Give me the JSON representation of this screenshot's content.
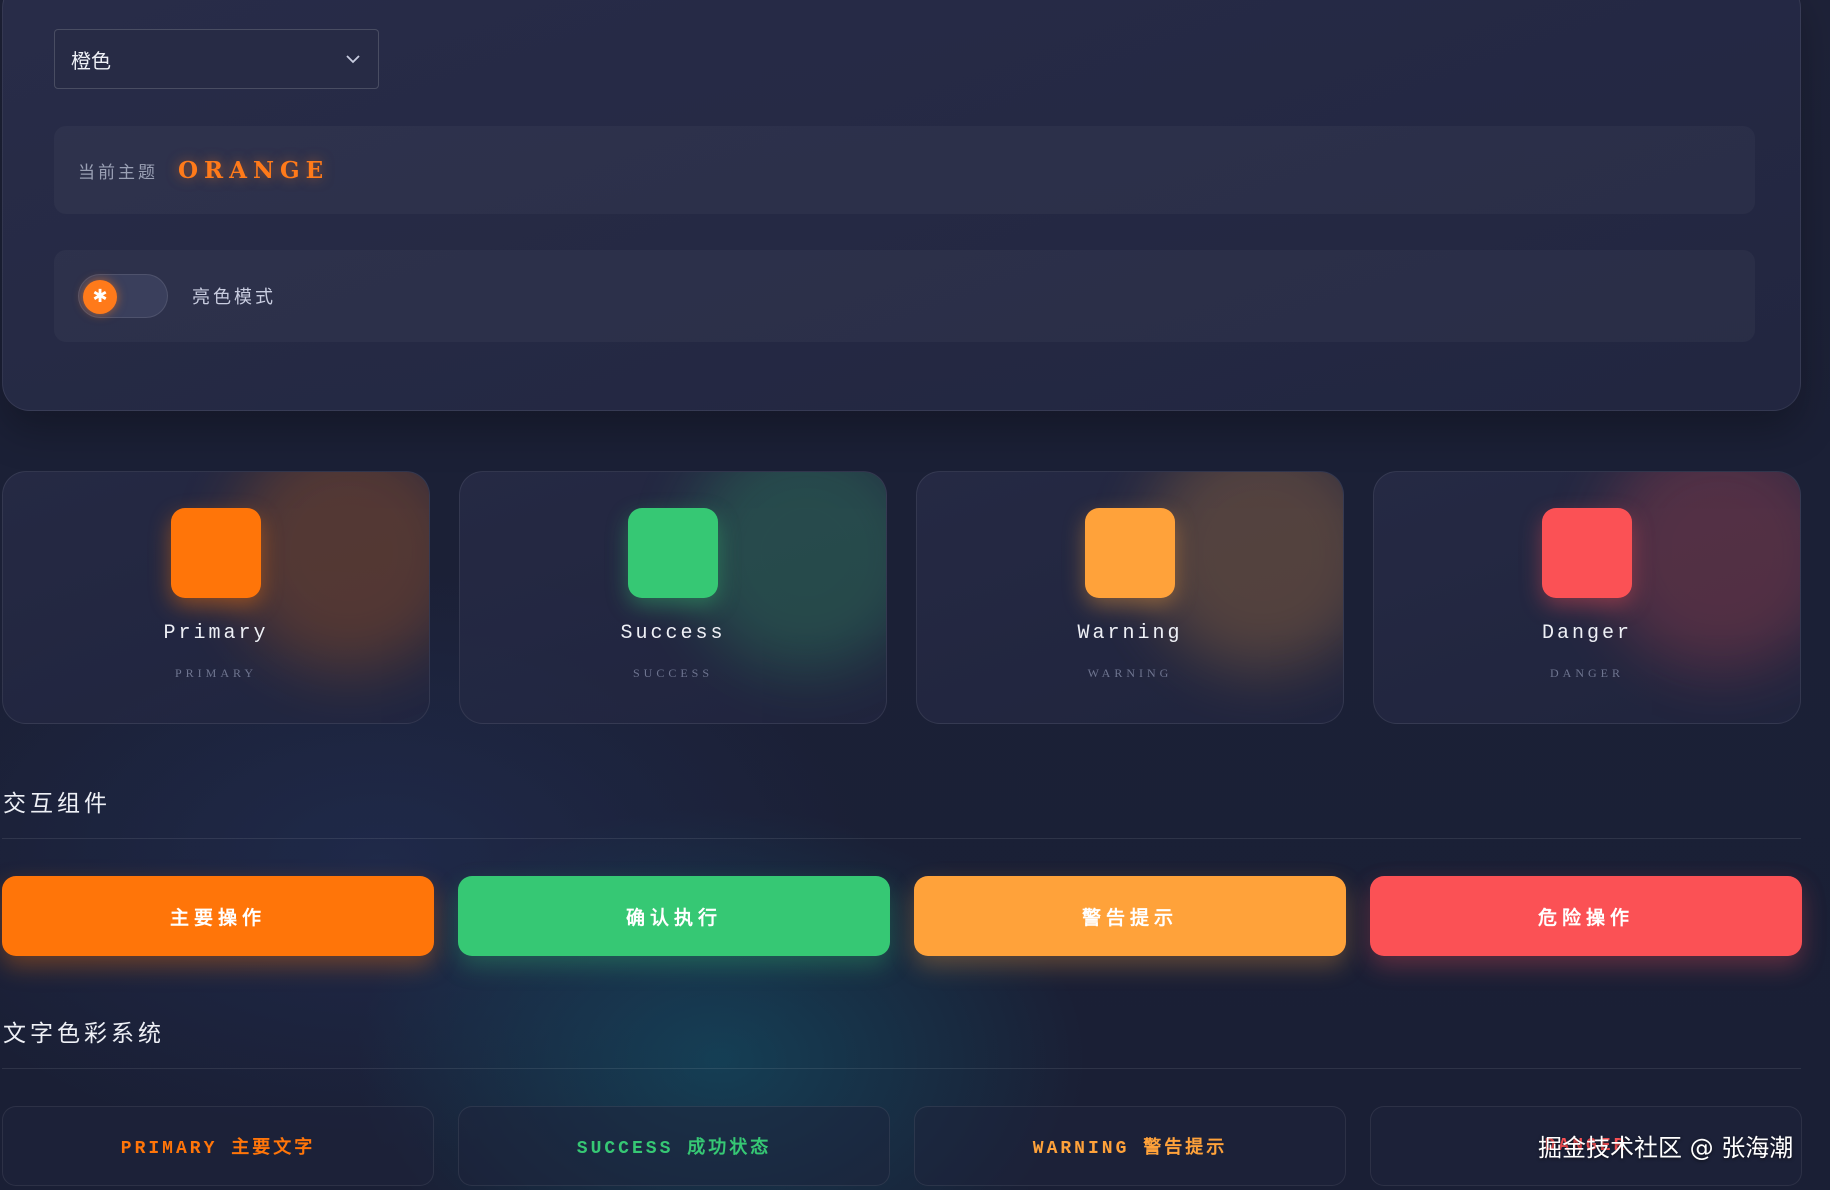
{
  "theme_select": {
    "value": "橙色"
  },
  "current_theme": {
    "label": "当前主题",
    "value": "ORANGE"
  },
  "light_mode": {
    "label": "亮色模式",
    "icon": "sun-icon"
  },
  "colors": {
    "primary": "#ff7509",
    "success": "#36c874",
    "warning": "#ffa23a",
    "danger": "#fb5155"
  },
  "cards": [
    {
      "name": "Primary",
      "sub": "PRIMARY",
      "color": "#ff7509"
    },
    {
      "name": "Success",
      "sub": "SUCCESS",
      "color": "#36c874"
    },
    {
      "name": "Warning",
      "sub": "WARNING",
      "color": "#ffa23a"
    },
    {
      "name": "Danger",
      "sub": "DANGER",
      "color": "#fb5155"
    }
  ],
  "sections": {
    "interactive": "交互组件",
    "text_colors": "文字色彩系统"
  },
  "buttons": [
    {
      "label": "主要操作"
    },
    {
      "label": "确认执行"
    },
    {
      "label": "警告提示"
    },
    {
      "label": "危险操作"
    }
  ],
  "text_samples": [
    {
      "label": "PRIMARY 主要文字"
    },
    {
      "label": "SUCCESS 成功状态"
    },
    {
      "label": "WARNING 警告提示"
    },
    {
      "label": "DANGER"
    }
  ],
  "watermark": "掘金技术社区 @ 张海潮"
}
